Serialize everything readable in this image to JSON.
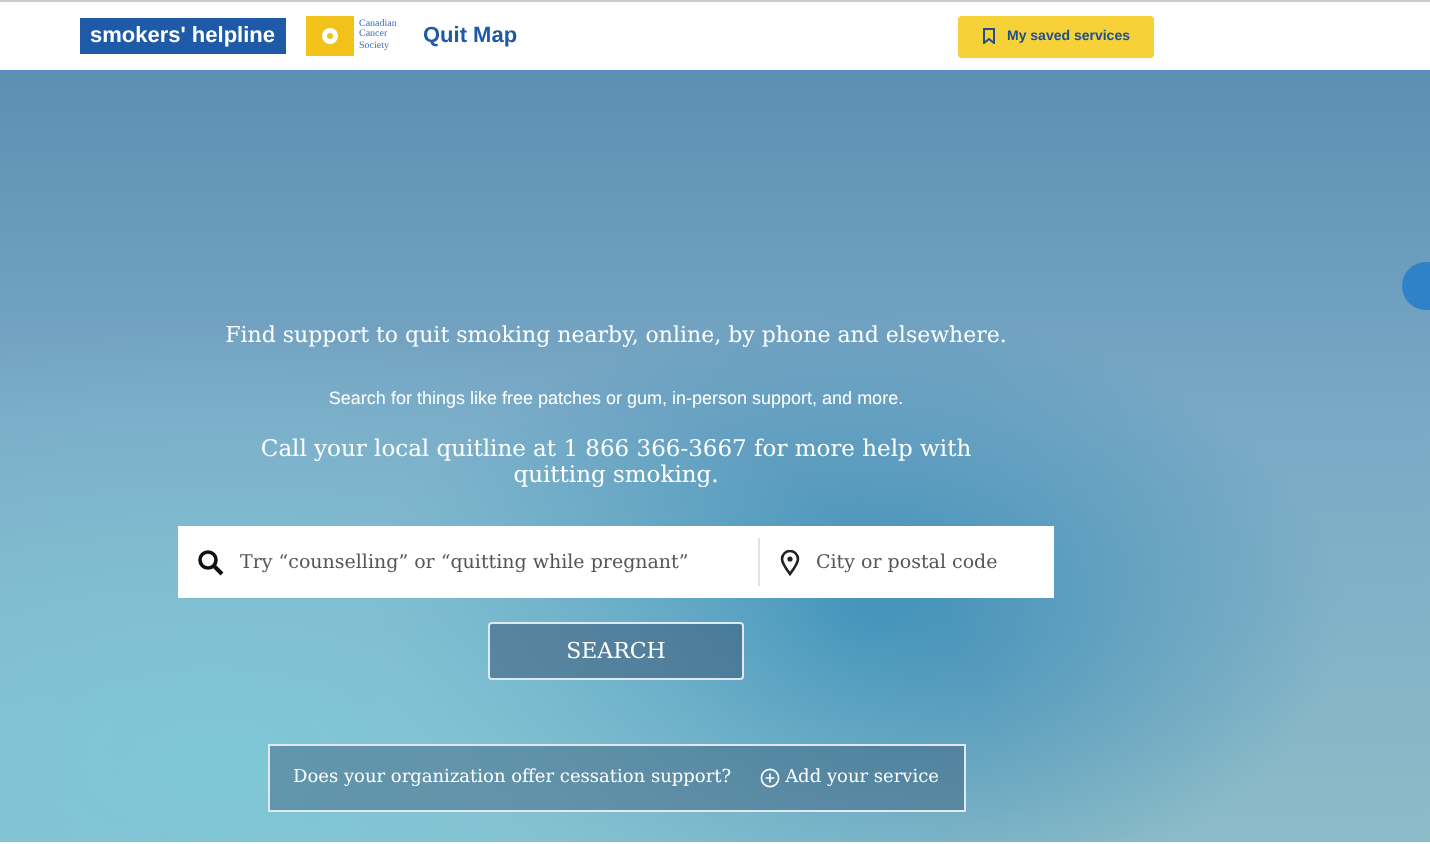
{
  "header": {
    "logo": "smokers' helpline",
    "partner_logo": "Canadian Cancer Society",
    "app_title": "Quit Map",
    "saved_button": "My saved services"
  },
  "hero": {
    "headline": "Find support to quit smoking nearby, online, by phone and elsewhere.",
    "subtitle": "Search for things like free patches or gum, in-person support, and more.",
    "quitline": "Call your local quitline at 1 866 366-3667 for more help with quitting smoking.",
    "search": {
      "placeholder": "Try “counselling” or “quitting while pregnant”"
    },
    "location": {
      "placeholder": "City or postal code"
    },
    "search_button": "SEARCH",
    "banner": {
      "question": "Does your organization offer cessation support?",
      "link": "Add your service"
    }
  }
}
